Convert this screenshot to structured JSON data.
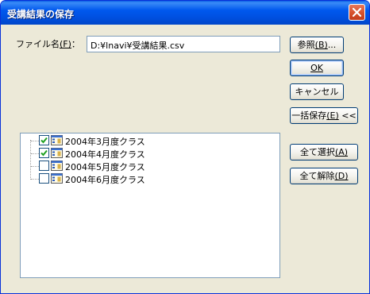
{
  "window": {
    "title": "受講結果の保存",
    "close_icon": "close-icon"
  },
  "file": {
    "label_text": "ファイル名",
    "label_mnemonic": "(F)",
    "label_suffix": "：",
    "value": "D:¥lnavi¥受講結果.csv"
  },
  "buttons": {
    "browse": {
      "text": "参照",
      "mnemonic": "(B)",
      "suffix": "..."
    },
    "ok": "OK",
    "cancel": "キャンセル",
    "batch_save": {
      "text": "一括保存",
      "mnemonic": "(E)",
      "suffix": " <<"
    },
    "select_all": {
      "text": "全て選択",
      "mnemonic": "(A)"
    },
    "deselect_all": {
      "text": "全て解除",
      "mnemonic": "(D)"
    }
  },
  "classes": [
    {
      "label": "2004年3月度クラス",
      "checked": true
    },
    {
      "label": "2004年4月度クラス",
      "checked": true
    },
    {
      "label": "2004年5月度クラス",
      "checked": false
    },
    {
      "label": "2004年6月度クラス",
      "checked": false
    }
  ],
  "colors": {
    "titlebar": "#0058ee",
    "dialog_bg": "#ece9d8",
    "check_mark": "#21a121",
    "input_border": "#7f9db9"
  }
}
